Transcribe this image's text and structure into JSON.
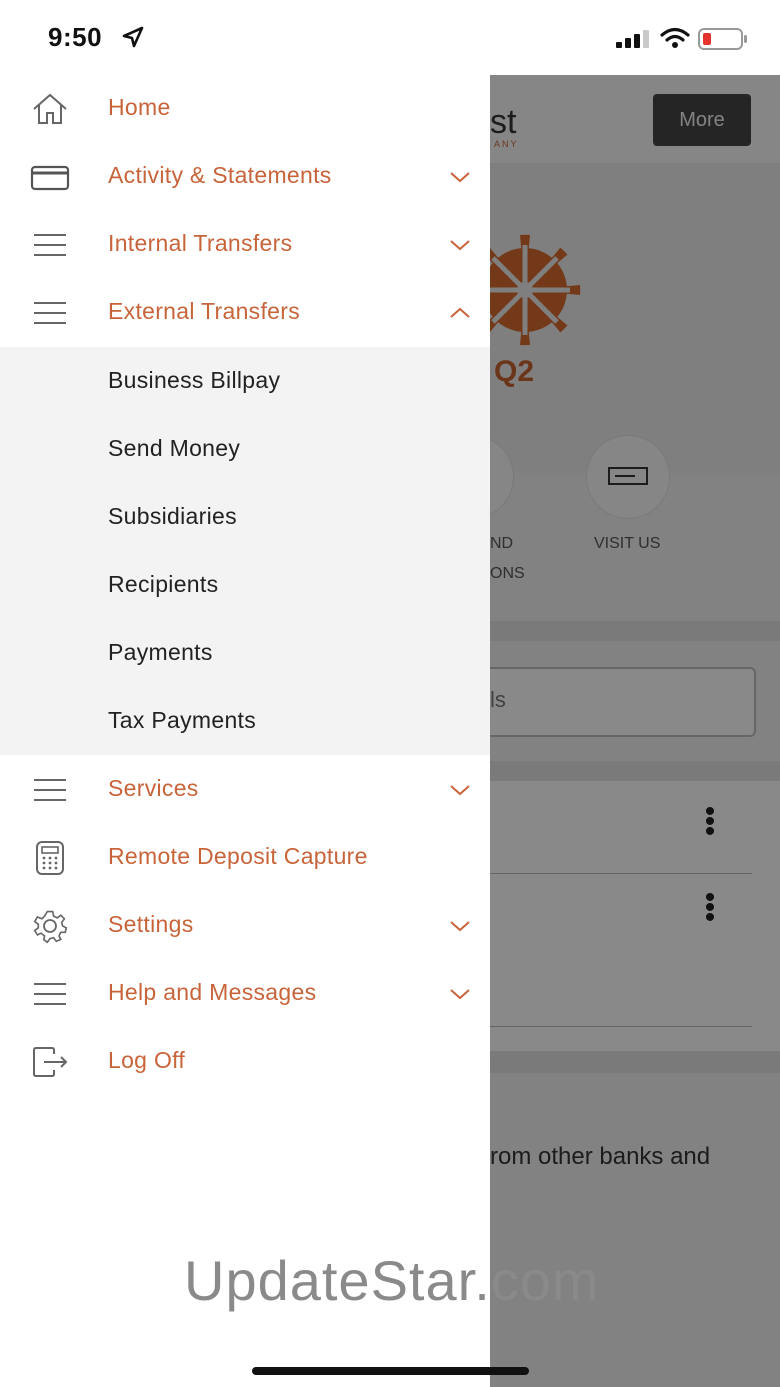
{
  "status_bar": {
    "time": "9:50"
  },
  "background_app": {
    "logo_text": "st",
    "logo_sub": "ANY",
    "more_label": "More",
    "brand_label": "Q2",
    "quick_action_left_line1": "ND",
    "quick_action_left_line2": "ONS",
    "quick_action_visit": "VISIT US",
    "input_fragment": "ls",
    "promo_text": "rom other banks and"
  },
  "menu": {
    "home": "Home",
    "activity": "Activity & Statements",
    "internal": "Internal Transfers",
    "external": "External Transfers",
    "external_sub": [
      "Business Billpay",
      "Send Money",
      "Subsidiaries",
      "Recipients",
      "Payments",
      "Tax Payments"
    ],
    "services": "Services",
    "rdc": "Remote Deposit Capture",
    "settings": "Settings",
    "help": "Help and Messages",
    "logoff": "Log Off"
  },
  "icons": {
    "home": "home-icon",
    "card": "card-icon",
    "menu": "hamburger-icon",
    "calculator": "calculator-icon",
    "gear": "gear-icon",
    "logout": "logout-icon"
  },
  "colors": {
    "accent": "#c8643a",
    "submenu_bg": "#f3f3f3"
  },
  "watermark": "UpdateStar.com"
}
